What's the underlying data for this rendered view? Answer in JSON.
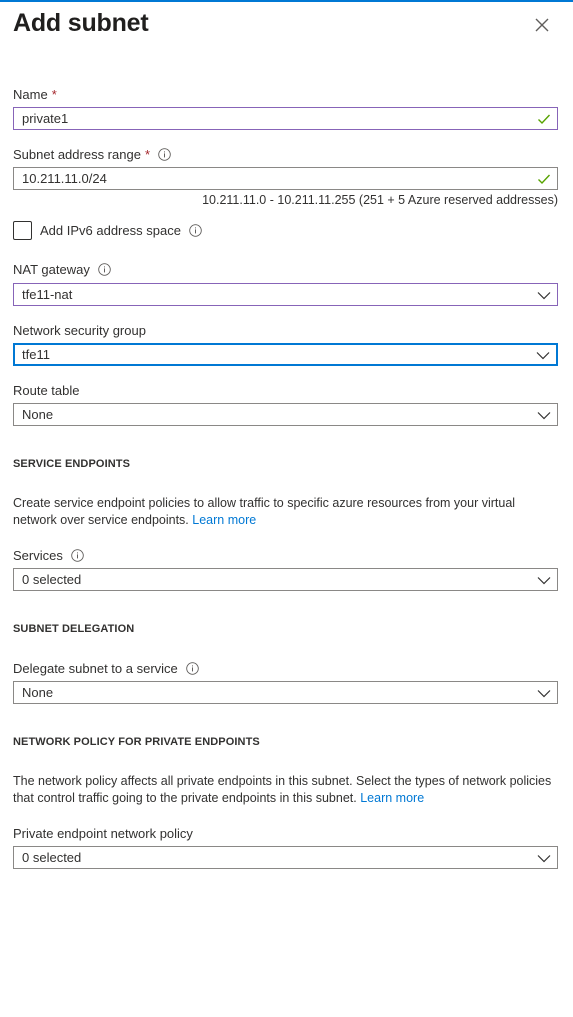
{
  "header": {
    "title": "Add subnet",
    "close_icon": "close-icon"
  },
  "name": {
    "label": "Name",
    "required_mark": "*",
    "value": "private1"
  },
  "subnet_range": {
    "label": "Subnet address range",
    "required_mark": "*",
    "value": "10.211.11.0/24",
    "hint": "10.211.11.0 - 10.211.11.255 (251 + 5 Azure reserved addresses)"
  },
  "ipv6": {
    "label": "Add IPv6 address space",
    "checked": false
  },
  "nat_gateway": {
    "label": "NAT gateway",
    "value": "tfe11-nat"
  },
  "nsg": {
    "label": "Network security group",
    "value": "tfe11"
  },
  "route_table": {
    "label": "Route table",
    "value": "None"
  },
  "service_endpoints": {
    "heading": "SERVICE ENDPOINTS",
    "description": "Create service endpoint policies to allow traffic to specific azure resources from your virtual network over service endpoints.",
    "link": "Learn more",
    "services_label": "Services",
    "services_value": "0 selected"
  },
  "subnet_delegation": {
    "heading": "SUBNET DELEGATION",
    "label": "Delegate subnet to a service",
    "value": "None"
  },
  "network_policy": {
    "heading": "NETWORK POLICY FOR PRIVATE ENDPOINTS",
    "description": "The network policy affects all private endpoints in this subnet. Select the types of network policies that control traffic going to the private endpoints in this subnet.",
    "link": "Learn more",
    "label": "Private endpoint network policy",
    "value": "0 selected"
  },
  "colors": {
    "accent": "#0078d4",
    "valid": "#57a300",
    "required": "#a4262c",
    "purple_border": "#8764b8"
  }
}
